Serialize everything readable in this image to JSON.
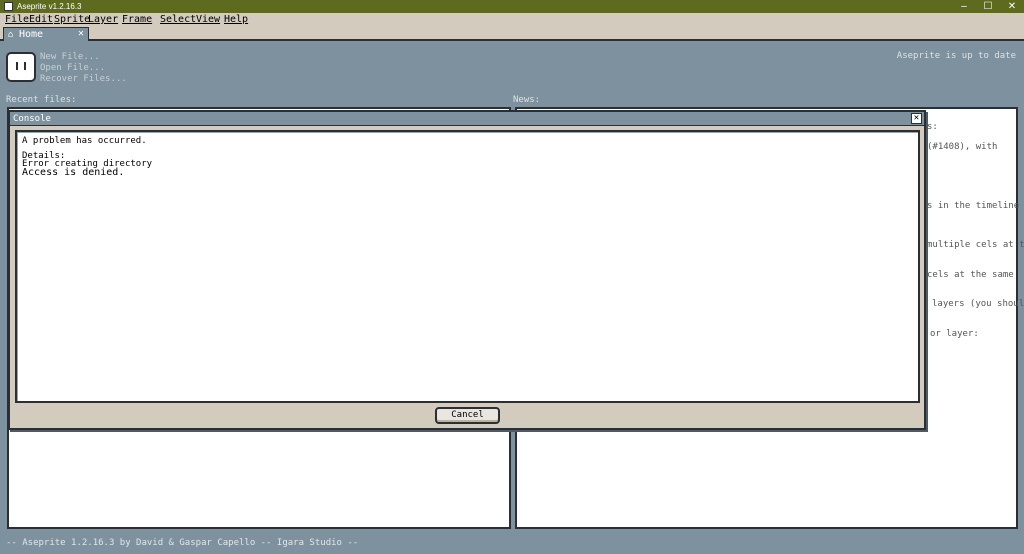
{
  "window": {
    "title": "Aseprite v1.2.16.3",
    "controls": {
      "minimize": "–",
      "maximize": "☐",
      "close": "✕"
    }
  },
  "menu": {
    "items": [
      "File",
      "Edit",
      "Sprite",
      "Layer",
      "Frame",
      "Select",
      "View",
      "Help"
    ]
  },
  "tabs": [
    {
      "label": "Home",
      "icon": "home-icon",
      "close": "✕"
    }
  ],
  "home": {
    "links": [
      "New File...",
      "Open File...",
      "Recover Files..."
    ],
    "update_status": "Aseprite is up to date",
    "recent_files_label": "Recent files:",
    "news_label": "News:",
    "news_fragments": [
      "s:",
      "(#1408), with",
      "s in the timeline",
      "multiple cels at the",
      "cels at the same",
      "layers (you should",
      "or layer:"
    ]
  },
  "dialog": {
    "title": "Console",
    "close": "✕",
    "lines": [
      "A problem has occurred.",
      "Details:",
      "Error creating directory",
      "Access is denied."
    ],
    "cancel_label": "Cancel"
  },
  "footer": {
    "text": "-- Aseprite 1.2.16.3 by David & Gaspar Capello -- Igara Studio --"
  },
  "colors": {
    "titlebar": "#5e6b1f",
    "menubar": "#d3cbbe",
    "workspace": "#7d929e",
    "border": "#2b2f33"
  }
}
